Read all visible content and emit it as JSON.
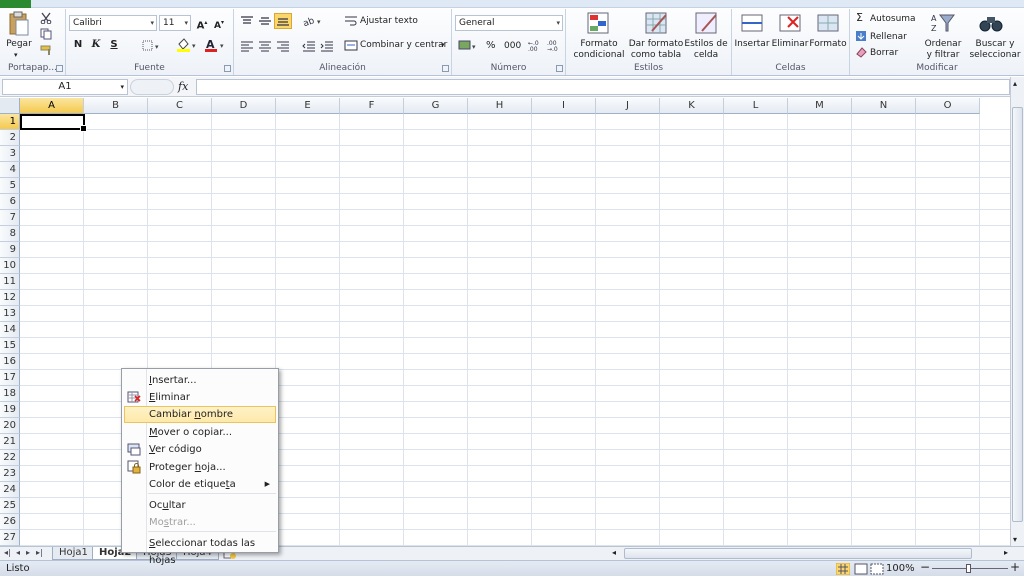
{
  "ribbon": {
    "clipboard": {
      "label": "Portapap...",
      "paste": "Pegar"
    },
    "font": {
      "label": "Fuente",
      "name": "Calibri",
      "size": "11",
      "bold": "N",
      "italic": "K",
      "underline": "S"
    },
    "alignment": {
      "label": "Alineación",
      "wrap": "Ajustar texto",
      "merge": "Combinar y centrar"
    },
    "number": {
      "label": "Número",
      "format": "General",
      "percent": "%",
      "thousands": "000"
    },
    "styles": {
      "label": "Estilos",
      "cond_format": [
        "Formato",
        "condicional"
      ],
      "as_table": [
        "Dar formato",
        "como tabla"
      ],
      "cell_styles": [
        "Estilos de",
        "celda"
      ]
    },
    "cells": {
      "label": "Celdas",
      "insert": "Insertar",
      "delete": "Eliminar",
      "format": "Formato"
    },
    "editing": {
      "label": "Modificar",
      "autosum": "Autosuma",
      "fill": "Rellenar",
      "clear": "Borrar",
      "sort": [
        "Ordenar",
        "y filtrar"
      ],
      "find": [
        "Buscar y",
        "seleccionar"
      ]
    }
  },
  "formula_bar": {
    "name_box": "A1",
    "fx": "fx",
    "value": ""
  },
  "columns": [
    "A",
    "B",
    "C",
    "D",
    "E",
    "F",
    "G",
    "H",
    "I",
    "J",
    "K",
    "L",
    "M",
    "N",
    "O"
  ],
  "rows": [
    "1",
    "2",
    "3",
    "4",
    "5",
    "6",
    "7",
    "8",
    "9",
    "10",
    "11",
    "12",
    "13",
    "14",
    "15",
    "16",
    "17",
    "18",
    "19",
    "20",
    "21",
    "22",
    "23",
    "24",
    "25",
    "26",
    "27"
  ],
  "active_cell": "A1",
  "sheet_tabs": [
    "Hoja1",
    "Hoja2",
    "Hoja3",
    "Hoja4"
  ],
  "active_sheet": "Hoja2",
  "status": {
    "ready": "Listo",
    "zoom": "100%"
  },
  "context_menu": {
    "items": [
      {
        "pre": "",
        "u": "I",
        "post": "nsertar...",
        "icon": "",
        "disabled": false,
        "highlight": false
      },
      {
        "pre": "",
        "u": "E",
        "post": "liminar",
        "icon": "delete-sheet-icon",
        "disabled": false,
        "highlight": false
      },
      {
        "pre": "Cambiar ",
        "u": "n",
        "post": "ombre",
        "icon": "",
        "disabled": false,
        "highlight": true
      },
      {
        "pre": "",
        "u": "M",
        "post": "over o copiar...",
        "icon": "",
        "disabled": false,
        "highlight": false
      },
      {
        "pre": "",
        "u": "V",
        "post": "er código",
        "icon": "view-code-icon",
        "disabled": false,
        "highlight": false
      },
      {
        "pre": "Proteger ",
        "u": "h",
        "post": "oja...",
        "icon": "protect-sheet-icon",
        "disabled": false,
        "highlight": false
      },
      {
        "pre": "Color de etique",
        "u": "t",
        "post": "a",
        "icon": "",
        "disabled": false,
        "highlight": false,
        "submenu": true
      },
      {
        "pre": "Oc",
        "u": "u",
        "post": "ltar",
        "icon": "",
        "disabled": false,
        "highlight": false
      },
      {
        "pre": "Mo",
        "u": "s",
        "post": "trar...",
        "icon": "",
        "disabled": true,
        "highlight": false
      },
      {
        "pre": "",
        "u": "S",
        "post": "eleccionar todas las hojas",
        "icon": "",
        "disabled": false,
        "highlight": false
      }
    ]
  },
  "colors": {
    "accent": "#f4c94e",
    "file_tab": "#2a8a2f",
    "highlight": "#fde9a8"
  }
}
